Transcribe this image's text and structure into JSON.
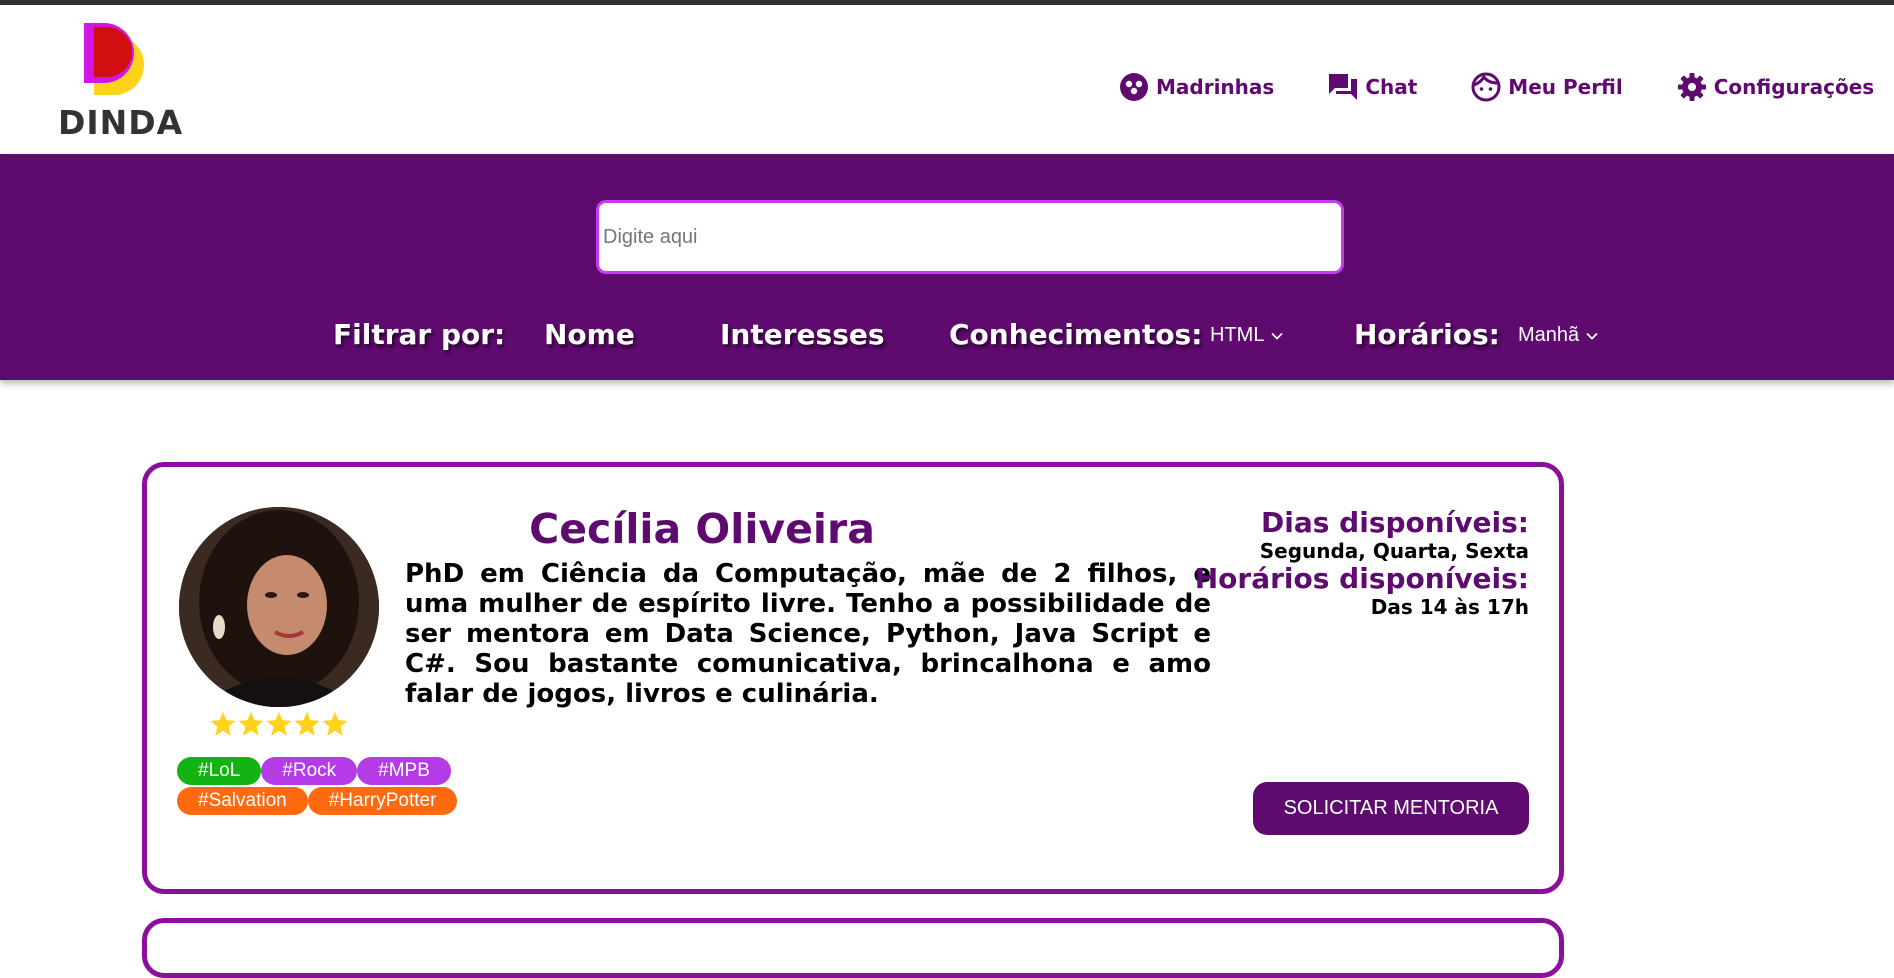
{
  "brand": {
    "logo_text": "DINDA",
    "primary": "#5e0a6e",
    "accent": "#c63df0"
  },
  "nav": {
    "items": [
      {
        "label": "Madrinhas",
        "icon": "group-icon"
      },
      {
        "label": "Chat",
        "icon": "chat-icon"
      },
      {
        "label": "Meu Perfil",
        "icon": "face-icon"
      },
      {
        "label": "Configurações",
        "icon": "gear-icon"
      }
    ]
  },
  "search": {
    "placeholder": "Digite aqui",
    "value": ""
  },
  "filters": {
    "title": "Filtrar por:",
    "name_label": "Nome",
    "interests_label": "Interesses",
    "knowledge_label": "Conhecimentos:",
    "knowledge_value": "HTML",
    "schedule_label": "Horários:",
    "schedule_value": "Manhã"
  },
  "mentor": {
    "name": "Cecília Oliveira",
    "bio": "PhD em Ciência da Computação, mãe de 2 filhos, e uma mulher de espírito livre. Tenho a possibilidade de ser mentora em Data Science, Python, Java Script e C#. Sou bastante comunicativa, brincalhona e amo falar de jogos, livros e culinária.",
    "rating": 5,
    "rating_max": 5,
    "tags_row1": [
      {
        "label": "#LoL",
        "color": "#12b312"
      },
      {
        "label": "#Rock",
        "color": "#b63be8"
      },
      {
        "label": "#MPB",
        "color": "#b63be8"
      }
    ],
    "tags_row2": [
      {
        "label": "#Salvation",
        "color": "#ff6a10"
      },
      {
        "label": "#HarryPotter",
        "color": "#ff6a10"
      }
    ],
    "days_label": "Dias disponíveis:",
    "days_value": "Segunda, Quarta, Sexta",
    "hours_label": "Horários disponíveis:",
    "hours_value": "Das 14 às 17h",
    "cta_label": "SOLICITAR MENTORIA"
  }
}
